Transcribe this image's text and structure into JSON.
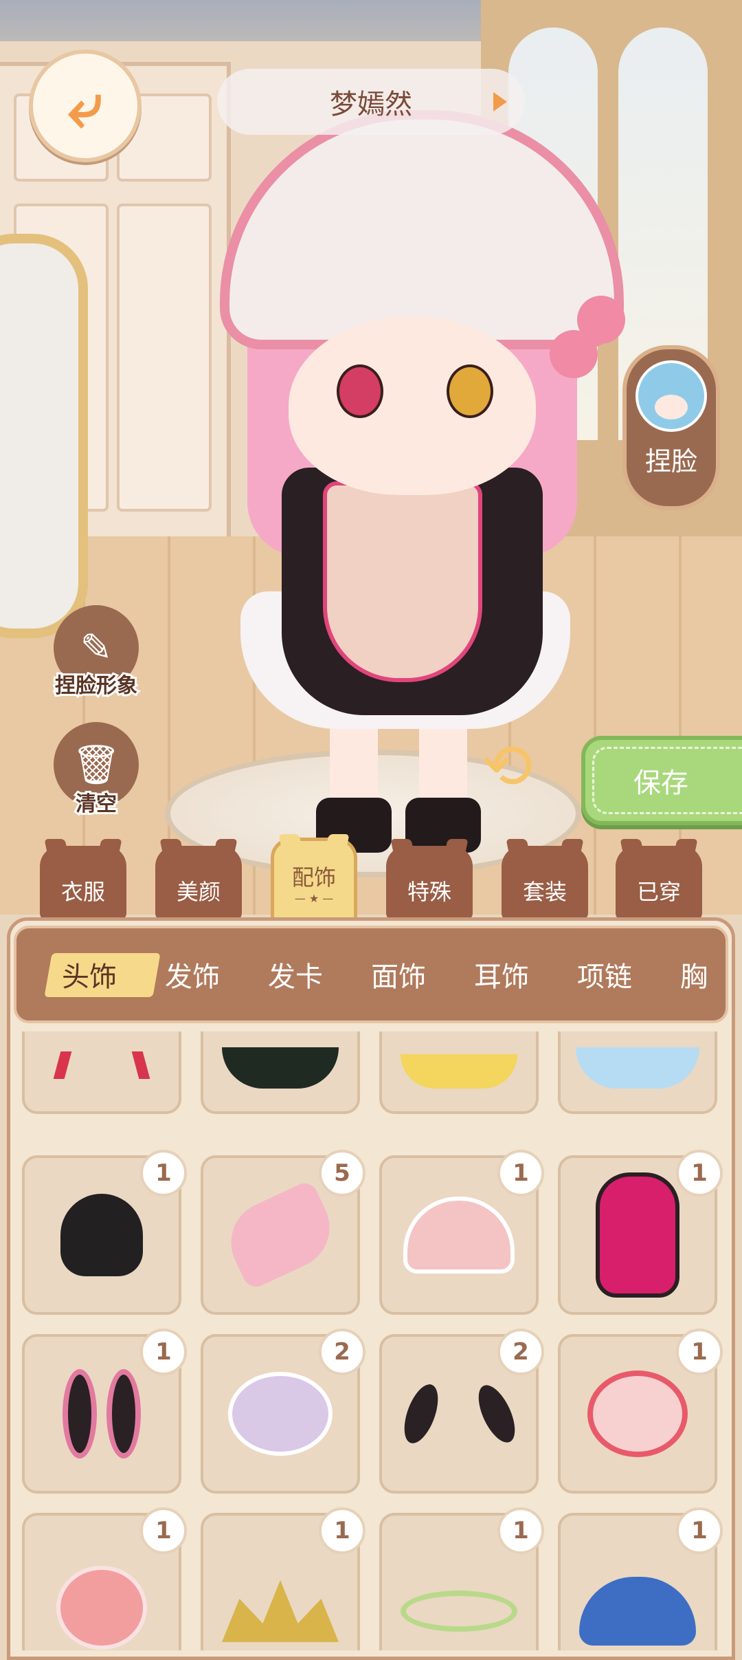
{
  "header": {
    "character_name": "梦嫣然"
  },
  "buttons": {
    "pinch_face": "捏脸",
    "pinch_face_image": "捏脸形象",
    "clear": "清空",
    "save": "保存"
  },
  "categories": [
    {
      "label": "衣服",
      "active": false
    },
    {
      "label": "美颜",
      "active": false
    },
    {
      "label": "配饰",
      "active": true
    },
    {
      "label": "特殊",
      "active": false
    },
    {
      "label": "套装",
      "active": false
    },
    {
      "label": "已穿",
      "active": false
    }
  ],
  "subcategories": [
    "头饰",
    "发饰",
    "发卡",
    "面饰",
    "耳饰",
    "项链",
    "胸"
  ],
  "active_subcategory": "头饰",
  "items": [
    {
      "name": "red-horns",
      "count": null
    },
    {
      "name": "witch-hat",
      "count": null
    },
    {
      "name": "cloud-beret",
      "count": null
    },
    {
      "name": "blue-bonnet",
      "count": null
    },
    {
      "name": "black-cat-hat",
      "count": "1"
    },
    {
      "name": "rose-ribbon-headpiece",
      "count": "5"
    },
    {
      "name": "pink-frill-bonnet",
      "count": "1"
    },
    {
      "name": "black-pink-lace-hood",
      "count": "1"
    },
    {
      "name": "bunny-ears-black",
      "count": "1"
    },
    {
      "name": "lavender-frill-cap",
      "count": "2"
    },
    {
      "name": "small-black-ears",
      "count": "2"
    },
    {
      "name": "peach-bonnet",
      "count": "1"
    },
    {
      "name": "pink-lace-bonnet",
      "count": "1"
    },
    {
      "name": "gold-leaf-crown",
      "count": "1"
    },
    {
      "name": "vine-circlet",
      "count": "1"
    },
    {
      "name": "bear-cap-blue",
      "count": "1"
    }
  ],
  "colors": {
    "accent": "#a9d87c",
    "brown": "#9a5d45",
    "highlight": "#f5d98a"
  }
}
